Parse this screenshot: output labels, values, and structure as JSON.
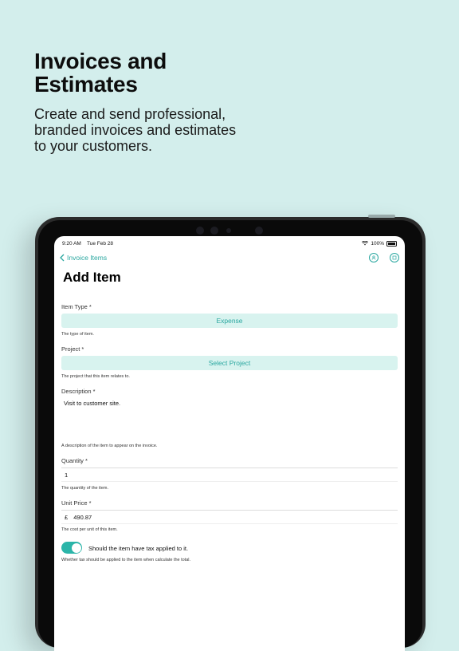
{
  "marketing": {
    "headline_line1": "Invoices and",
    "headline_line2": "Estimates",
    "sub_line1": "Create and send professional,",
    "sub_line2": "branded invoices and estimates",
    "sub_line3": "to your customers."
  },
  "status_bar": {
    "time": "9:20 AM",
    "date": "Tue Feb 28",
    "battery": "100%"
  },
  "nav": {
    "back_label": "Invoice Items"
  },
  "page": {
    "title": "Add Item"
  },
  "form": {
    "item_type": {
      "label": "Item Type *",
      "value": "Expense",
      "hint": "The type of item."
    },
    "project": {
      "label": "Project *",
      "value": "Select Project",
      "hint": "The project that this item relates to."
    },
    "description": {
      "label": "Description *",
      "value": "Visit to customer site.",
      "hint": "A description of the item to appear on the invoice."
    },
    "quantity": {
      "label": "Quantity *",
      "value": "1",
      "hint": "The quantity of the item."
    },
    "unit_price": {
      "label": "Unit Price *",
      "currency": "£",
      "value": "490.87",
      "hint": "The cost per unit of this item."
    },
    "tax": {
      "label": "Should the item have tax applied to it.",
      "hint": "Whether tax should be applied to the item when calculate the total.",
      "enabled": true
    }
  },
  "colors": {
    "background": "#d3eeec",
    "accent": "#2aa7a0",
    "pill": "#d8f3ef"
  }
}
